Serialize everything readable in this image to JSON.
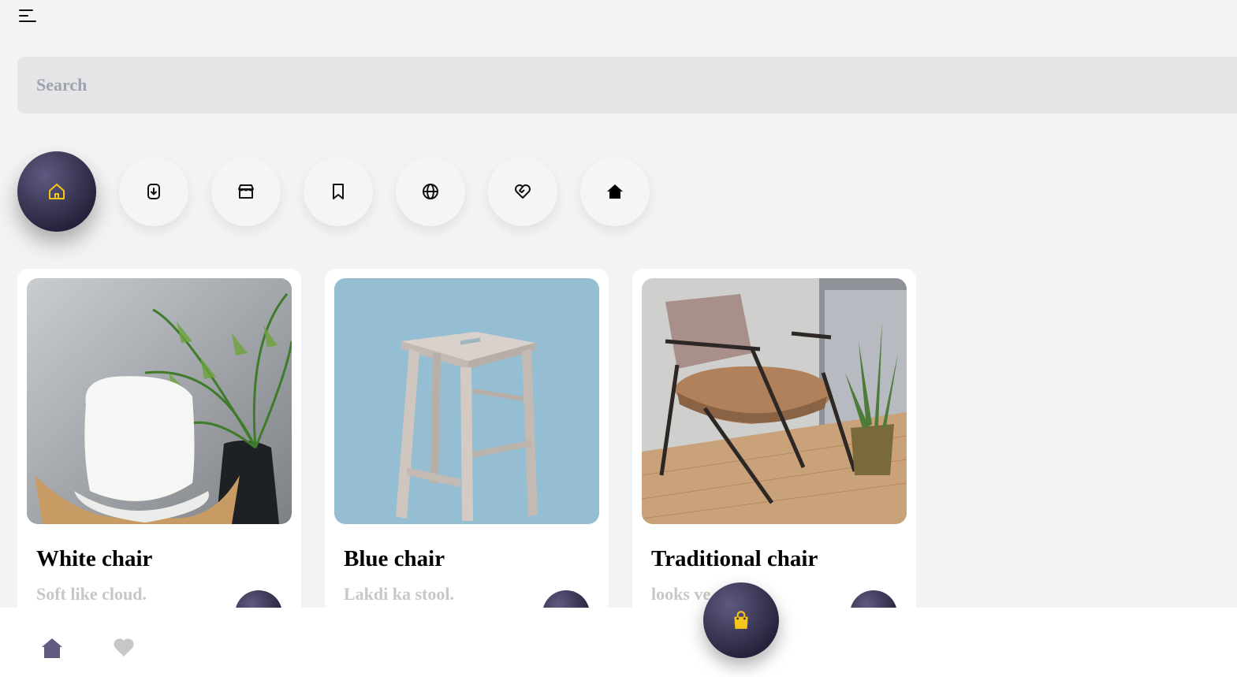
{
  "header": {
    "menu_icon": "hamburger-menu-icon"
  },
  "search": {
    "placeholder": "Search",
    "value": ""
  },
  "categories": [
    {
      "icon": "home-outline-icon",
      "active": true
    },
    {
      "icon": "download-icon",
      "active": false
    },
    {
      "icon": "store-icon",
      "active": false
    },
    {
      "icon": "bookmark-icon",
      "active": false
    },
    {
      "icon": "globe-icon",
      "active": false
    },
    {
      "icon": "heart-handshake-icon",
      "active": false
    },
    {
      "icon": "home-solid-icon",
      "active": false
    }
  ],
  "products": [
    {
      "title": "White chair",
      "subtitle": "Soft like cloud."
    },
    {
      "title": "Blue chair",
      "subtitle": "Lakdi ka stool."
    },
    {
      "title": "Traditional chair",
      "subtitle": "looks ve"
    }
  ],
  "bottom_nav": {
    "home_icon": "home-icon",
    "favorite_icon": "heart-icon",
    "cart_icon": "shopping-bag-icon"
  },
  "colors": {
    "accent": "#f5c518",
    "dark": "#2b2940",
    "nav_active": "#5e5a80",
    "muted": "#c7c7c7"
  }
}
